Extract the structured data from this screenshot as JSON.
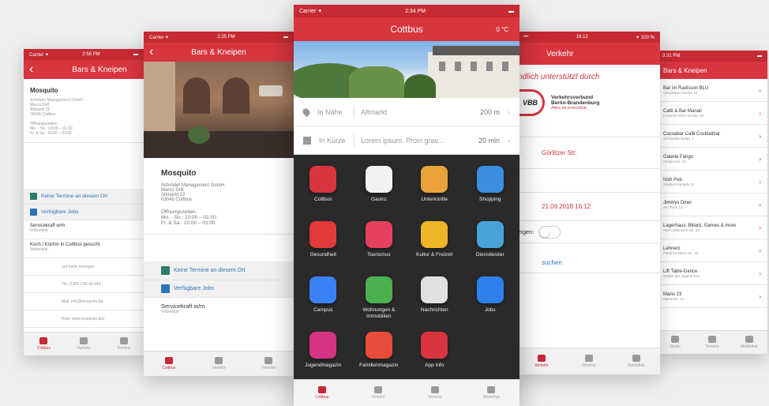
{
  "p1": {
    "status": {
      "carrier": "Carrier ✦",
      "time": "2:58 PM"
    },
    "nav_title": "Bars & Kneipen",
    "venue": {
      "name": "Mosquito",
      "lines": [
        "Schröder Management GmbH",
        "Marco Drill",
        "Altmarkt 22",
        "03046 Cottbus"
      ],
      "hours_label": "Öffnungszeiten:",
      "hours": [
        "Mo. - So.: 10:00 – 01:00",
        "Fr. & Sa.: 10:00 – 03:00"
      ]
    },
    "events_label": "Keine Termine an diesem Ort",
    "jobs_label": "Verfügbare Jobs",
    "jobs": [
      {
        "title": "Servicekraft w/m",
        "sub": "Vollzeitjob"
      },
      {
        "title": "Koch / Köchin in Cottbus gesucht",
        "sub": "Vollzeitjob"
      }
    ],
    "actions": [
      "auf Karte anzeigen",
      "Tel.: 0355 2 86 90 444",
      "Mail: info@mosquito.biz",
      "Web: www.mosquito.biz/"
    ],
    "tabs": [
      "Cottbus",
      "Verkehr",
      "Termine"
    ]
  },
  "p2": {
    "status": {
      "carrier": "Carrier ✦",
      "time": "2:35 PM"
    },
    "nav_title": "Bars & Kneipen",
    "venue": {
      "name": "Mosquito",
      "lines": [
        "Schröder Management GmbH",
        "Marco Drill",
        "Altmarkt 22",
        "03046 Cottbus"
      ],
      "hours_label": "Öffnungszeiten:",
      "hours": [
        "Mo. - So.: 10:00 – 01:00",
        "Fr. & Sa.: 10:00 – 03:00"
      ]
    },
    "events_label": "Keine Termine an diesem Ort",
    "jobs_label": "Verfügbare Jobs",
    "job": {
      "title": "Servicekraft w/m",
      "sub": "Vollzeitjob"
    },
    "tabs": [
      "Cottbus",
      "Verkehr",
      "Termine"
    ]
  },
  "p3": {
    "status": {
      "carrier": "Carrier ✦",
      "time": "2:34 PM"
    },
    "nav_title": "Cottbus",
    "weather": "0 °C",
    "nearby": {
      "label": "In Nähe",
      "place": "Altmarkt",
      "dist": "200 m"
    },
    "soon": {
      "label": "In Kürze",
      "text": "Lorem ipsum. Proin grav...",
      "time": "20 min"
    },
    "tiles": [
      {
        "label": "Cottbus",
        "icon": "crest-icon",
        "color": "#d8353f"
      },
      {
        "label": "Gastro",
        "icon": "chef-hat-icon",
        "color": "#f2f2f2"
      },
      {
        "label": "Unterkünfte",
        "icon": "bed-icon",
        "color": "#e9a23b"
      },
      {
        "label": "Shopping",
        "icon": "tag-icon",
        "color": "#3d8ee0"
      },
      {
        "label": "Gesundheit",
        "icon": "pharmacy-icon",
        "color": "#e23a3a"
      },
      {
        "label": "Tourismus",
        "icon": "camera-icon",
        "color": "#e5405e"
      },
      {
        "label": "Kultur & Freizeit",
        "icon": "theater-mask-icon",
        "color": "#f0b429"
      },
      {
        "label": "Dienstleister",
        "icon": "tools-icon",
        "color": "#4aa3d8"
      },
      {
        "label": "Campus",
        "icon": "campus-icon",
        "color": "#3b82f6"
      },
      {
        "label": "Wohnungen & Immobilien",
        "icon": "door-icon",
        "color": "#4caf50"
      },
      {
        "label": "Nachrichten",
        "icon": "newspaper-icon",
        "color": "#e0e0e0"
      },
      {
        "label": "Jobs",
        "icon": "buildings-icon",
        "color": "#2f80ed"
      },
      {
        "label": "Jugendmagazin",
        "icon": "lcf-logo-icon",
        "color": "#d63384"
      },
      {
        "label": "Familienmagazin",
        "icon": "flower-icon",
        "color": "#e74c3c"
      },
      {
        "label": "App Info",
        "icon": "info-icon",
        "color": "#d8353f"
      }
    ],
    "tabs": [
      "Cottbus",
      "Verkehr",
      "Termine",
      "Meldeflak"
    ]
  },
  "p4": {
    "status": {
      "time": "16:12",
      "battery": "✦ 100 %"
    },
    "nav_title": "Verkehr",
    "sponsor_heading": "ndlich unterstützt durch",
    "vbb": {
      "logo": "VBB",
      "line1": "Verkehrsverbund",
      "line2": "Berlin-Brandenburg",
      "line3": "Alles ist erreichbar."
    },
    "station": "Görlitzer Str.",
    "date": "21.09.2018 16:12",
    "toggle_label": "eigen:",
    "search_label": "suchen",
    "tabs": [
      "Verkehr",
      "Termine",
      "Meldeflak"
    ]
  },
  "p5": {
    "status": {
      "time": "3:31 PM"
    },
    "nav_title": "Bars & Kneipen",
    "items": [
      {
        "name": "Bar im Radisson BLU",
        "addr": "Vetschauer Straße 12"
      },
      {
        "name": "Café & Bar Manali",
        "addr": "Friedrich-Ebert-Straße 36"
      },
      {
        "name": "Cocoabar Café Cocktailbar",
        "addr": "Schlosskirchplatz 1"
      },
      {
        "name": "Galerie Fango",
        "addr": "Amalienstr. 10"
      },
      {
        "name": "Irish Pub",
        "addr": "Stadtpromenade 10"
      },
      {
        "name": "Jimmys Diner",
        "addr": "Am Turm 14"
      },
      {
        "name": "Lagerhaus. Billard, Games & more",
        "addr": "Karl-Liebknecht-Str. 25"
      },
      {
        "name": "Lehnerz",
        "addr": "Friedrich-Ebert-Str. 15"
      },
      {
        "name": "Lift Table-Dance",
        "addr": "Straße der Jugend 164"
      },
      {
        "name": "Mano 23",
        "addr": "Marienstr. 23"
      }
    ],
    "tabs": [
      "Guide",
      "Termine",
      "Meldeflak"
    ]
  }
}
